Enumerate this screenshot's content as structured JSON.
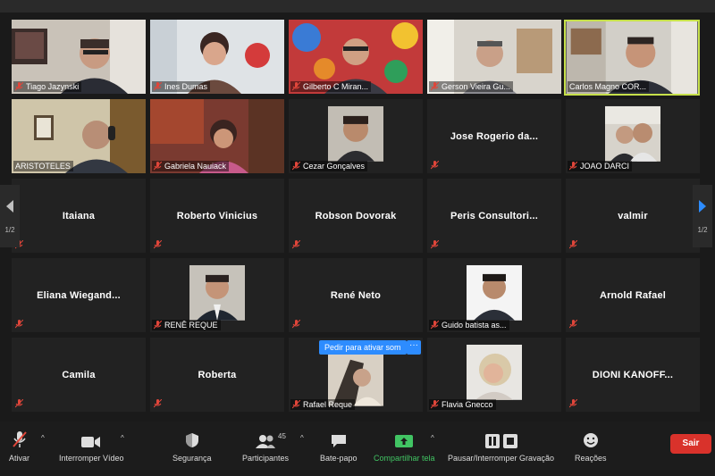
{
  "tiles": [
    {
      "name": "Tiago Jazynski",
      "type": "video"
    },
    {
      "name": "Ines Dumas",
      "type": "video"
    },
    {
      "name": "Gilberto C Miran...",
      "type": "video"
    },
    {
      "name": "Gerson Vieira Gu...",
      "type": "video"
    },
    {
      "name": "Carlos Magno COR...",
      "type": "video",
      "active": true
    },
    {
      "name": "ARISTOTELES",
      "type": "video"
    },
    {
      "name": "Gabriela Nauiack",
      "type": "video"
    },
    {
      "name": "Cezar Gonçalves",
      "type": "photo"
    },
    {
      "name": "Jose Rogerio da...",
      "type": "name"
    },
    {
      "name": "JOAO DARCI",
      "type": "photo"
    },
    {
      "name": "Itaiana",
      "type": "name"
    },
    {
      "name": "Roberto Vinicius",
      "type": "name"
    },
    {
      "name": "Robson Dovorak",
      "type": "name"
    },
    {
      "name": "Peris  Consultori...",
      "type": "name"
    },
    {
      "name": "valmir",
      "type": "name"
    },
    {
      "name": "Eliana  Wiegand...",
      "type": "name"
    },
    {
      "name": "RENÊ REQUE",
      "type": "photo"
    },
    {
      "name": "René Neto",
      "type": "name"
    },
    {
      "name": "Guido batista as...",
      "type": "photo"
    },
    {
      "name": "Arnold Rafael",
      "type": "name"
    },
    {
      "name": "Camila",
      "type": "name"
    },
    {
      "name": "Roberta",
      "type": "name"
    },
    {
      "name": "Rafael Reque",
      "type": "photo"
    },
    {
      "name": "Flavia Gnecco",
      "type": "photo"
    },
    {
      "name": "DIONI  KANOFF...",
      "type": "name"
    }
  ],
  "pager": {
    "left_page": "1/2",
    "right_page": "1/2"
  },
  "unmute_request": {
    "label": "Pedir para ativar som",
    "more": "···"
  },
  "toolbar": {
    "mute": "Ativar",
    "video": "Interromper Vídeo",
    "security": "Segurança",
    "participants": "Participantes",
    "participants_count": "45",
    "chat": "Bate-papo",
    "share": "Compartilhar tela",
    "record": "Pausar/Interromper Gravação",
    "reactions": "Reações",
    "leave": "Sair"
  },
  "colors": {
    "accent": "#2d8cff",
    "active_speaker": "#c6e04a",
    "share_green": "#41c463",
    "leave_red": "#d9322b",
    "muted_red": "#e0463a"
  }
}
